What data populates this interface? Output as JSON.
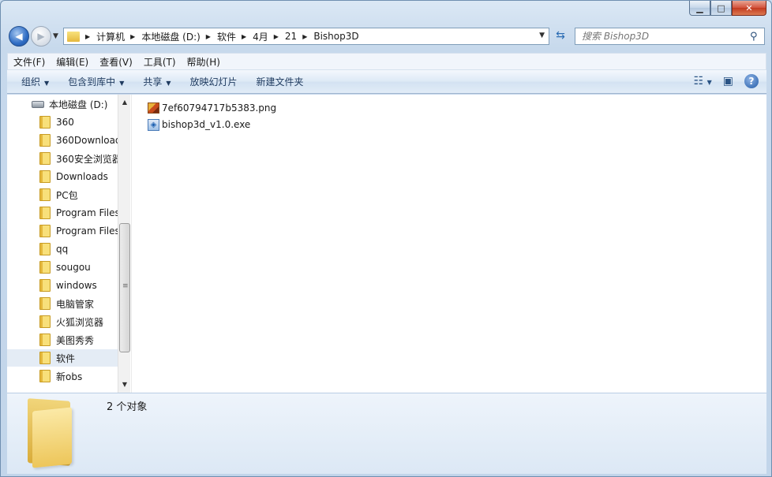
{
  "window": {
    "caption": {
      "minimize": "▁",
      "maximize": "□",
      "close": "✕"
    }
  },
  "address": {
    "crumbs": [
      "计算机",
      "本地磁盘 (D:)",
      "软件",
      "4月",
      "21",
      "Bishop3D"
    ]
  },
  "search": {
    "placeholder": "搜索 Bishop3D"
  },
  "menu": [
    "文件(F)",
    "编辑(E)",
    "查看(V)",
    "工具(T)",
    "帮助(H)"
  ],
  "toolbar": {
    "organize": "组织",
    "include_library": "包含到库中",
    "share": "共享",
    "slideshow": "放映幻灯片",
    "new_folder": "新建文件夹"
  },
  "tree": {
    "disk": "本地磁盘 (D:)",
    "folders": [
      "360",
      "360Download",
      "360安全浏览器",
      "Downloads",
      "PC包",
      "Program Files",
      "Program Files",
      "qq",
      "sougou",
      "windows",
      "电脑管家",
      "火狐浏览器",
      "美图秀秀",
      "软件",
      "新obs"
    ],
    "selected": "软件"
  },
  "files": [
    {
      "name": "7ef60794717b5383.png",
      "type": "png"
    },
    {
      "name": "bishop3d_v1.0.exe",
      "type": "exe"
    }
  ],
  "details": {
    "count": "2 个对象"
  }
}
